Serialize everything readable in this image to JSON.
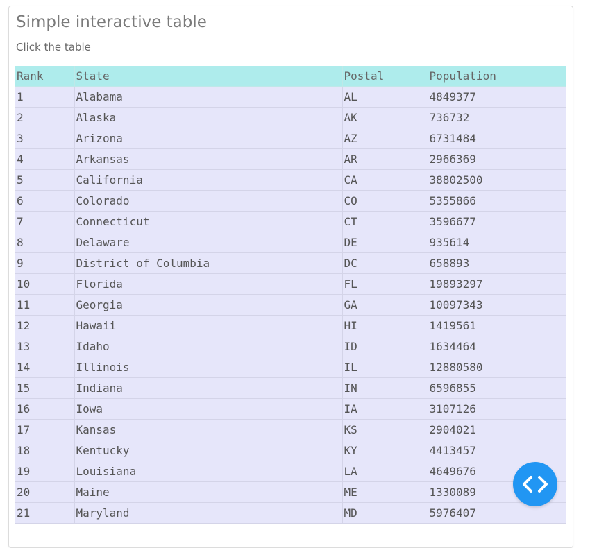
{
  "page": {
    "title": "Simple interactive table",
    "subtitle": "Click the table"
  },
  "table": {
    "headers": [
      "Rank",
      "State",
      "Postal",
      "Population"
    ],
    "rows": [
      [
        "1",
        "Alabama",
        "AL",
        "4849377"
      ],
      [
        "2",
        "Alaska",
        "AK",
        "736732"
      ],
      [
        "3",
        "Arizona",
        "AZ",
        "6731484"
      ],
      [
        "4",
        "Arkansas",
        "AR",
        "2966369"
      ],
      [
        "5",
        "California",
        "CA",
        "38802500"
      ],
      [
        "6",
        "Colorado",
        "CO",
        "5355866"
      ],
      [
        "7",
        "Connecticut",
        "CT",
        "3596677"
      ],
      [
        "8",
        "Delaware",
        "DE",
        "935614"
      ],
      [
        "9",
        "District of Columbia",
        "DC",
        "658893"
      ],
      [
        "10",
        "Florida",
        "FL",
        "19893297"
      ],
      [
        "11",
        "Georgia",
        "GA",
        "10097343"
      ],
      [
        "12",
        "Hawaii",
        "HI",
        "1419561"
      ],
      [
        "13",
        "Idaho",
        "ID",
        "1634464"
      ],
      [
        "14",
        "Illinois",
        "IL",
        "12880580"
      ],
      [
        "15",
        "Indiana",
        "IN",
        "6596855"
      ],
      [
        "16",
        "Iowa",
        "IA",
        "3107126"
      ],
      [
        "17",
        "Kansas",
        "KS",
        "2904021"
      ],
      [
        "18",
        "Kentucky",
        "KY",
        "4413457"
      ],
      [
        "19",
        "Louisiana",
        "LA",
        "4649676"
      ],
      [
        "20",
        "Maine",
        "ME",
        "1330089"
      ],
      [
        "21",
        "Maryland",
        "MD",
        "5976407"
      ]
    ]
  },
  "fab": {
    "icon": "code-icon",
    "color": "#2196f3"
  },
  "colors": {
    "header_bg": "#aeecec",
    "row_bg": "#e6e6fa"
  }
}
